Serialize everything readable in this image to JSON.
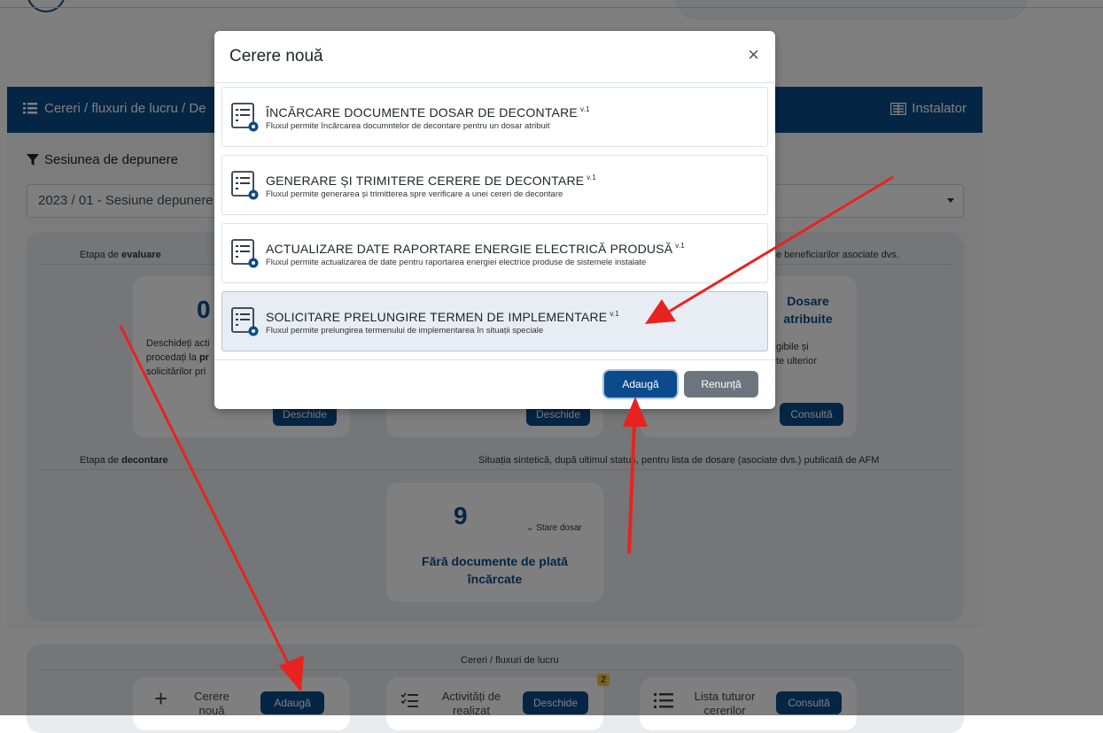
{
  "header": {
    "breadcrumb": "Cereri / fluxuri de lucru / De",
    "installer": "Instalator"
  },
  "session": {
    "label": "Sesiunea de depunere",
    "selected": "2023 / 01 - Sesiune depunere"
  },
  "evaluation": {
    "label_prefix": "Etapa de ",
    "label_bold": "evaluare",
    "right_label": "e beneficiarilor asociate dvs.",
    "card1": {
      "count": "0",
      "text_1": "Deschideți acti",
      "text_2_prefix": "procedați la ",
      "text_2_bold": "pr",
      "text_3": "solicitărilor pri",
      "button": "Deschide"
    },
    "card2": {
      "button": "Deschide"
    },
    "card3": {
      "title_1": "Dosare",
      "title_2": "atribuite",
      "text_1": "gibile și",
      "text_2": "te ulterior",
      "button": "Consultă"
    }
  },
  "settlement": {
    "label_prefix": "Etapa de ",
    "label_bold": "decontare",
    "right_label": "Situația sintetică, după ultimul status, pentru lista de dosare (asociate dvs.) publicată de AFM",
    "card": {
      "count": "9",
      "toggle": "Stare dosar",
      "title_1": "Fără documente de plată",
      "title_2": "încărcate"
    }
  },
  "workflows": {
    "label": "Cereri / fluxuri de lucru",
    "new_request": {
      "label_1": "Cerere",
      "label_2": "nouă",
      "button": "Adaugă"
    },
    "activities": {
      "label_1": "Activități de",
      "label_2": "realizat",
      "button": "Deschide",
      "badge": "2"
    },
    "all_requests": {
      "label_1": "Lista tuturor",
      "label_2": "cererilor",
      "button": "Consultă"
    }
  },
  "modal": {
    "title": "Cerere nouă",
    "close": "×",
    "options": [
      {
        "title": "ÎNCĂRCARE DOCUMENTE DOSAR DE DECONTARE",
        "version": "v.1",
        "description": "Fluxul permite încărcarea documntelor de decontare pentru un dosar atribuit"
      },
      {
        "title": "GENERARE ȘI TRIMITERE CERERE DE DECONTARE",
        "version": "v.1",
        "description": "Fluxul permite generarea și trimitterea spre verificare a unei cereri de decontare"
      },
      {
        "title": "ACTUALIZARE DATE RAPORTARE ENERGIE ELECTRICĂ PRODUSĂ",
        "version": "v.1",
        "description": "Fluxul permite actualizarea de date pentru raportarea energiei electrice produse de sistemele instalate"
      },
      {
        "title": "SOLICITARE PRELUNGIRE TERMEN DE IMPLEMENTARE",
        "version": "v.1",
        "description": "Fluxul permite prelungirea termenului de implementarea în situații speciale"
      }
    ],
    "add_button": "Adaugă",
    "cancel_button": "Renunță"
  },
  "colors": {
    "primary": "#0b4a8b",
    "secondary": "#6c757d",
    "annotation_arrow": "#e8231f",
    "badge": "#f2c94c"
  }
}
